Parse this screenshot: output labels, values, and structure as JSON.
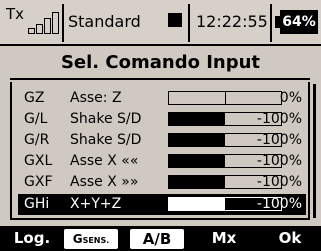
{
  "status": {
    "tx_label": "Tx",
    "model": "Standard",
    "time": "12:22:55",
    "battery": "64%"
  },
  "title": "Sel. Comando Input",
  "rows": [
    {
      "code": "GZ",
      "name": "Asse: Z",
      "value": "0%",
      "fill": 0.0
    },
    {
      "code": "G/L",
      "name": "Shake S/D",
      "value": "-100%",
      "fill": 0.5
    },
    {
      "code": "G/R",
      "name": "Shake S/D",
      "value": "-100%",
      "fill": 0.5
    },
    {
      "code": "GXL",
      "name": "Asse X ««",
      "value": "-100%",
      "fill": 0.5
    },
    {
      "code": "GXF",
      "name": "Asse X »»",
      "value": "-100%",
      "fill": 0.5
    },
    {
      "code": "GHi",
      "name": "X+Y+Z",
      "value": "-100%",
      "fill": 0.5,
      "selected": true
    }
  ],
  "softkeys": {
    "log": "Log.",
    "gsens": "G",
    "gsens_sub": "SENS.",
    "ab": "A∕B",
    "mx": "Mx",
    "ok": "Ok"
  },
  "colors": {
    "screen_bg": "#cfc9c1",
    "ink": "#000000"
  }
}
